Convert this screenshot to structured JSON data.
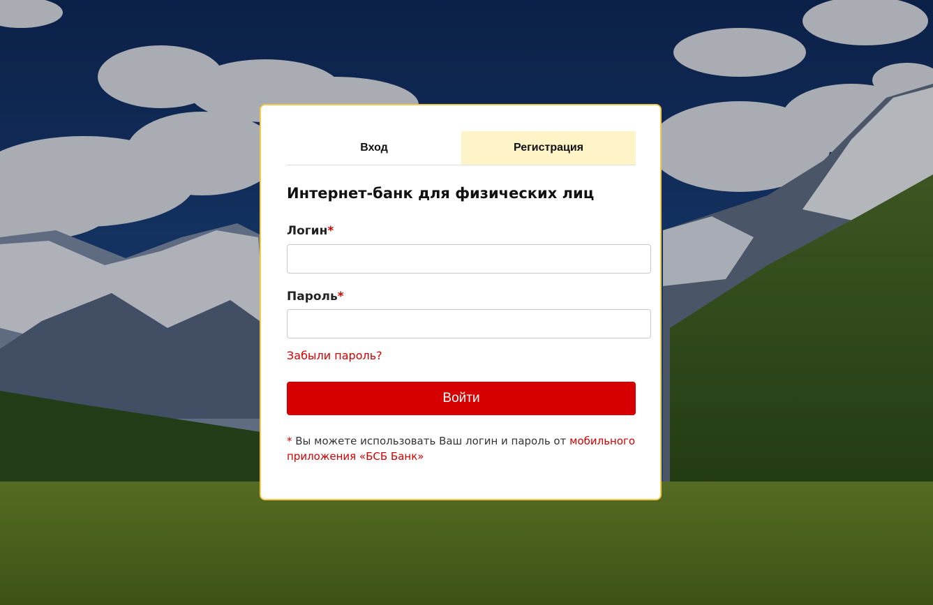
{
  "tabs": {
    "login_label": "Вход",
    "register_label": "Регистрация"
  },
  "form": {
    "title": "Интернет-банк для физических лиц",
    "login_label": "Логин",
    "password_label": "Пароль",
    "required_mark": "*",
    "login_value": "",
    "password_value": "",
    "forgot_link": "Забыли пароль?",
    "submit_label": "Войти"
  },
  "note": {
    "star": "*",
    "text": " Вы можете использовать Ваш логин и пароль от ",
    "link_text": "мобильного приложения «БСБ Банк»"
  },
  "colors": {
    "accent": "#d60000",
    "card_border": "#f2c94c",
    "inactive_tab": "#fff3c8"
  }
}
